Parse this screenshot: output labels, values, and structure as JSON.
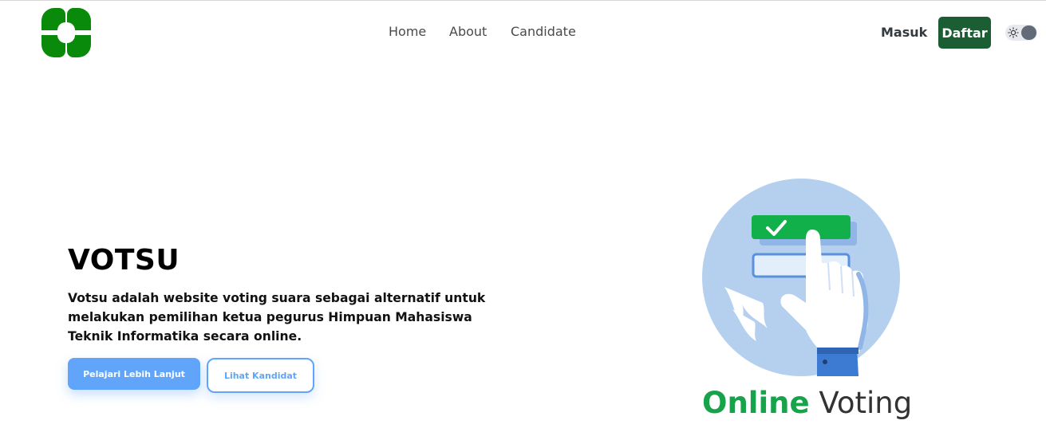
{
  "header": {
    "logo": {
      "icon": "clover-logo-icon",
      "color": "#0a8a0a"
    },
    "nav": [
      {
        "label": "Home"
      },
      {
        "label": "About"
      },
      {
        "label": "Candidate"
      }
    ],
    "login_label": "Masuk",
    "register_label": "Daftar",
    "theme_toggle": {
      "icon": "sun-icon",
      "state": "light"
    }
  },
  "hero": {
    "title": "VOTSU",
    "description": "Votsu adalah website voting suara sebagai alternatif untuk melakukan pemilihan ketua pegurus Himpuan Mahasiswa Teknik Informatika secara online.",
    "primary_button": "Pelajari Lebih Lanjut",
    "secondary_button": "Lihat Kandidat"
  },
  "illustration": {
    "icon": "online-voting-hand-icon",
    "caption_strong": "Online",
    "caption_light": "Voting"
  },
  "colors": {
    "brand_green": "#1b5e33",
    "accent_blue": "#60a5fa",
    "caption_green": "#17a34a"
  }
}
